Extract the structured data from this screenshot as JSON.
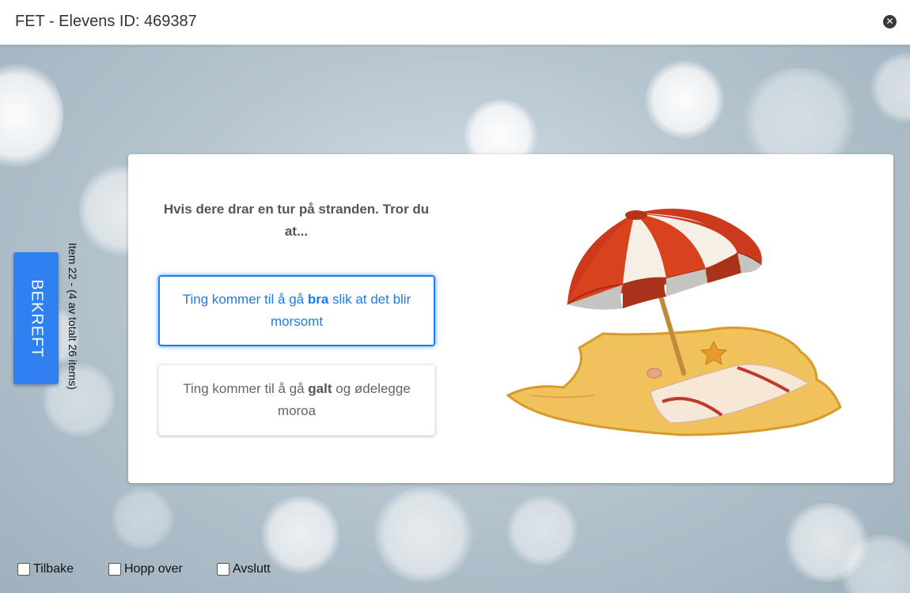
{
  "window": {
    "title": "FET - Elevens ID: 469387",
    "close_icon": "close-circle-icon"
  },
  "sidebar": {
    "confirm_label": "BEKREFT",
    "item_counter": "Item 22 - (4 av totalt 26 items)"
  },
  "question": {
    "text": "Hvis dere drar en tur på stranden. Tror du at...",
    "options": [
      {
        "prefix": "Ting kommer til å gå ",
        "bold": "bra",
        "suffix": " slik at det blir morsomt",
        "selected": true
      },
      {
        "prefix": "Ting kommer til å gå ",
        "bold": "galt",
        "suffix": " og ødelegge moroa",
        "selected": false
      }
    ],
    "image": "beach-umbrella-illustration"
  },
  "footer": {
    "back_label": "Tilbake",
    "skip_label": "Hopp over",
    "finish_label": "Avslutt"
  },
  "colors": {
    "accent": "#2f80f0",
    "selected_text": "#1f7ae8"
  }
}
